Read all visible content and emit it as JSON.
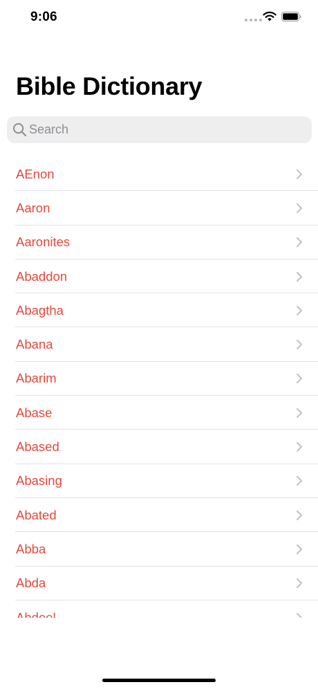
{
  "status_bar": {
    "time": "9:06",
    "signal_icon": "signal-dots-icon",
    "wifi_icon": "wifi-icon",
    "battery_icon": "battery-icon"
  },
  "header": {
    "title": "Bible Dictionary"
  },
  "search": {
    "placeholder": "Search",
    "value": "",
    "icon": "magnifying-glass-icon"
  },
  "colors": {
    "accent": "#e5483b",
    "separator": "#e2e2e5",
    "search_background": "#eeeeef",
    "chevron": "#c4c4c7"
  },
  "list": {
    "items": [
      {
        "label": "AEnon"
      },
      {
        "label": "Aaron"
      },
      {
        "label": "Aaronites"
      },
      {
        "label": "Abaddon"
      },
      {
        "label": "Abagtha"
      },
      {
        "label": "Abana"
      },
      {
        "label": "Abarim"
      },
      {
        "label": "Abase"
      },
      {
        "label": "Abased"
      },
      {
        "label": "Abasing"
      },
      {
        "label": "Abated"
      },
      {
        "label": "Abba"
      },
      {
        "label": "Abda"
      },
      {
        "label": "Abdeel"
      }
    ],
    "item_icon": "chevron-right-icon"
  }
}
